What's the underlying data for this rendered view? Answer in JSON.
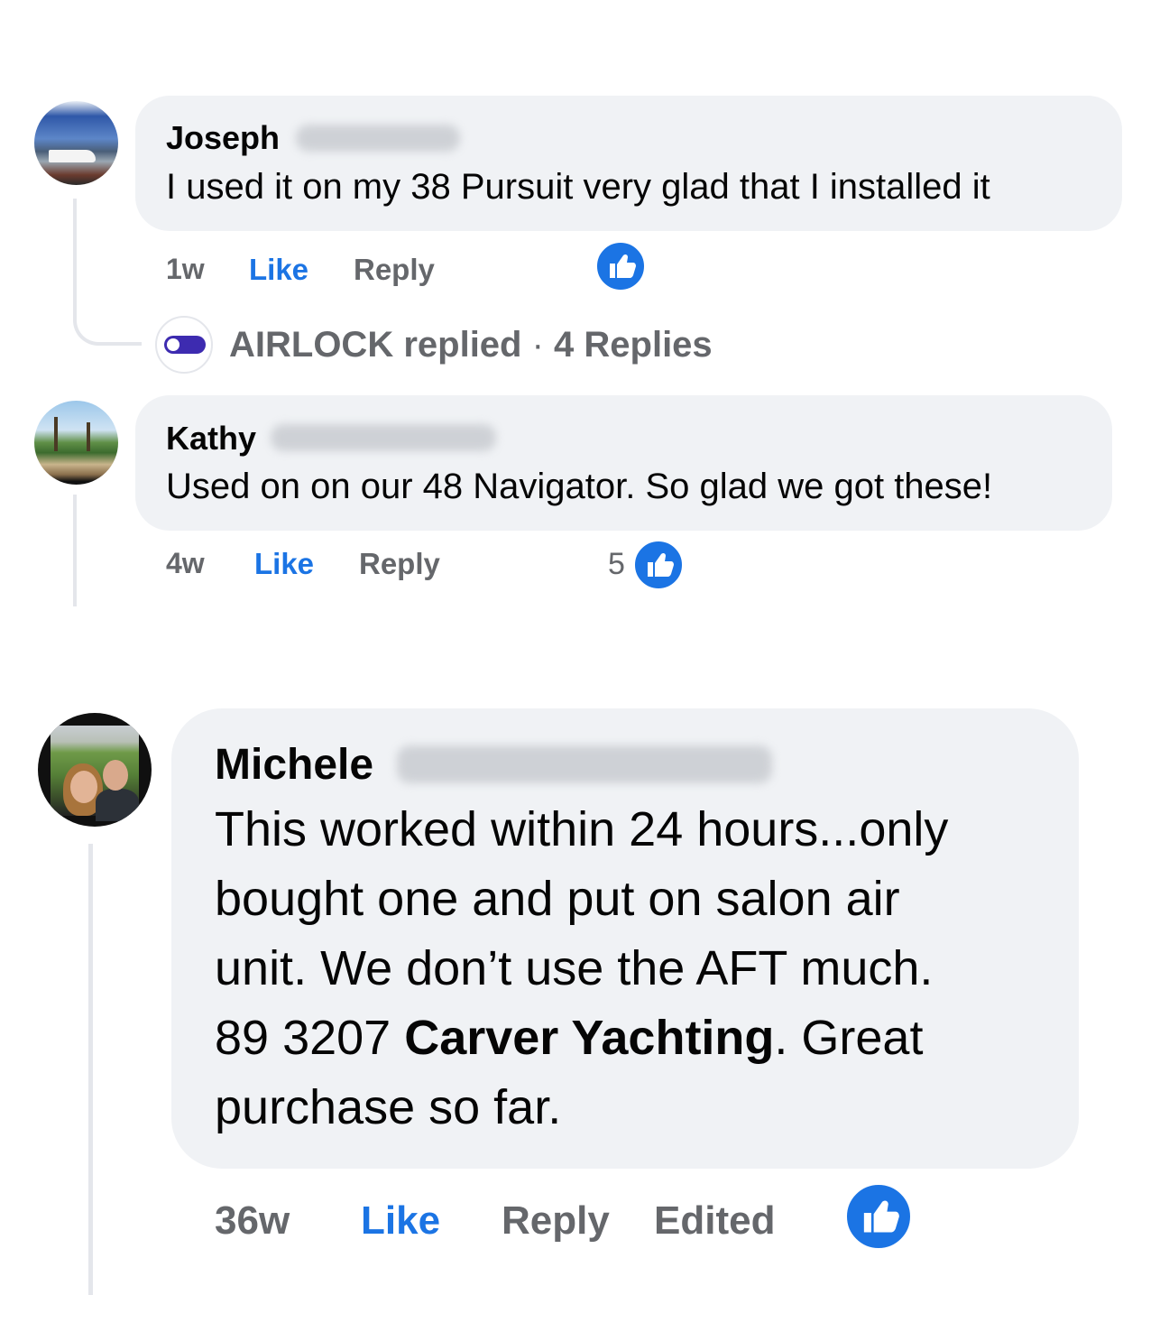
{
  "comments": [
    {
      "author": "Joseph",
      "text": "I used it on my 38 Pursuit very glad that I installed it",
      "time": "1w",
      "like_label": "Like",
      "reply_label": "Reply",
      "reaction_count": ""
    },
    {
      "author": "Kathy",
      "text": "Used on on our 48 Navigator. So glad we got these!",
      "time": "4w",
      "like_label": "Like",
      "reply_label": "Reply",
      "reaction_count": "5"
    },
    {
      "author": "Michele",
      "text_lines": [
        "This worked within 24 hours...only",
        "bought one and put on salon air",
        "unit. We don’t use the AFT much."
      ],
      "line4_prefix": "89 3207 ",
      "line4_bold": "Carver Yachting",
      "line4_suffix": ". Great",
      "line5": "purchase so far.",
      "time": "36w",
      "like_label": "Like",
      "reply_label": "Reply",
      "edited_label": "Edited"
    }
  ],
  "reply_summary": {
    "replier": "AIRLOCK",
    "action": " replied",
    "separator": " · ",
    "count_label": "4 Replies"
  },
  "colors": {
    "bubble": "#f0f2f5",
    "like_blue": "#1b74e4",
    "meta_gray": "#65676b",
    "thread_line": "#e4e6eb"
  },
  "icons": {
    "reaction": "thumbs-up-icon",
    "airlock_logo": "toggle-logo-icon"
  }
}
